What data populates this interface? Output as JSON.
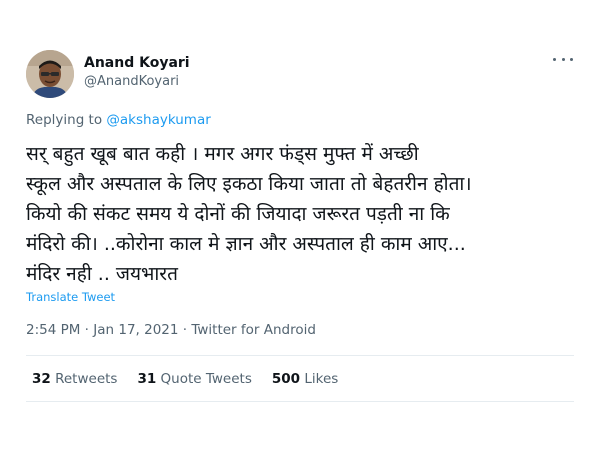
{
  "author": {
    "display_name": "Anand Koyari",
    "handle": "@AnandKoyari"
  },
  "menu": {
    "icon": "more-horizontal-icon"
  },
  "replying": {
    "prefix": "Replying to",
    "mention": "@akshaykumar"
  },
  "tweet": {
    "lines": [
      "सर् बहुत खूब बात कही । मगर अगर फंड्स मुफ्त में  अच्छी",
      "स्कूल और अस्पताल के लिए इकठा किया जाता तो बेहतरीन होता।",
      "कियो की संकट समय ये दोनों की जियादा जरूरत पड़ती ना कि",
      "मंदिरो की। ..कोरोना काल मे ज्ञान और अस्पताल ही काम आए...",
      "मंदिर नही .. जयभारत"
    ],
    "translate_label": "Translate Tweet",
    "timestamp": "2:54 PM · Jan 17, 2021 · Twitter for Android"
  },
  "stats": {
    "retweets_count": "32",
    "retweets_label": "Retweets",
    "quotes_count": "31",
    "quotes_label": "Quote Tweets",
    "likes_count": "500",
    "likes_label": "Likes"
  },
  "colors": {
    "link": "#1d9bf0",
    "secondary_text": "#536471",
    "primary_text": "#0f1419"
  }
}
